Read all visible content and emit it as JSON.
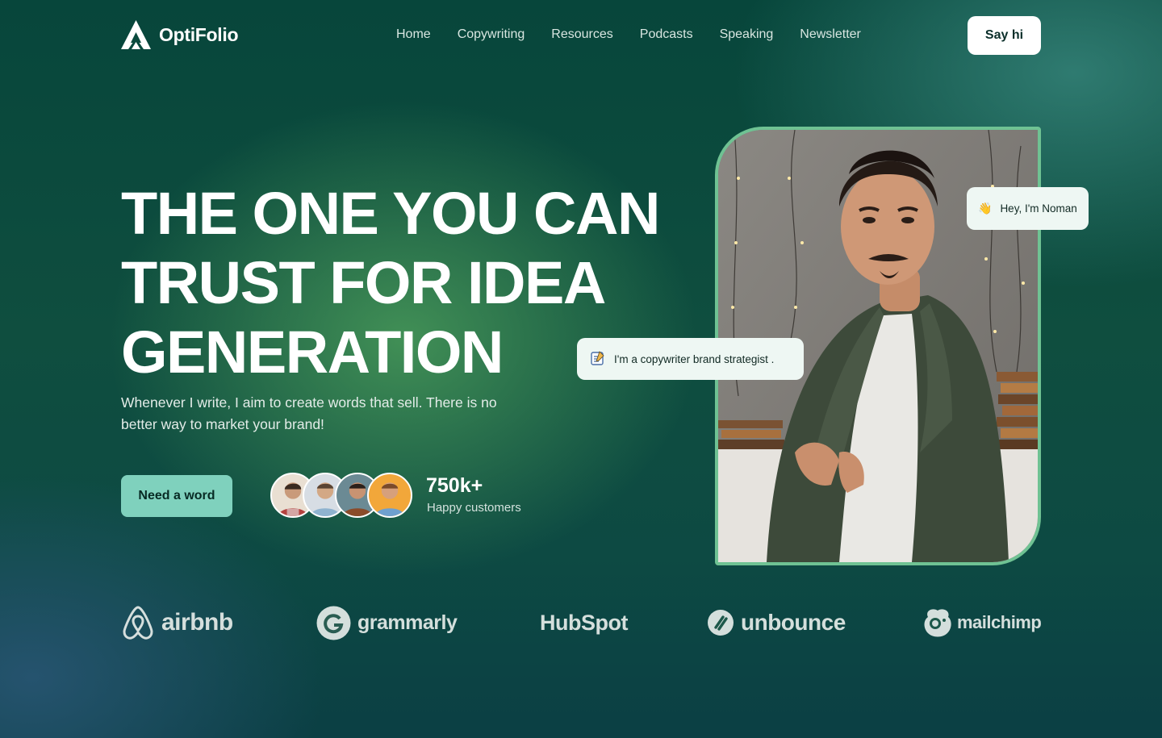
{
  "brand": {
    "name": "OptiFolio"
  },
  "nav": {
    "items": [
      "Home",
      "Copywriting",
      "Resources",
      "Podcasts",
      "Speaking",
      "Newsletter"
    ]
  },
  "header": {
    "cta_label": "Say hi"
  },
  "hero": {
    "headline_lines": [
      "THE ONE YOU CAN",
      "TRUST FOR IDEA",
      "GENERATION"
    ],
    "subtitle": "Whenever I write, I aim to create words that sell. There is no better way to market your brand!",
    "cta_label": "Need a word",
    "stat_value": "750k+",
    "stat_label": "Happy customers"
  },
  "bubbles": {
    "greeting": "Hey, I'm Noman",
    "greeting_icon": "waving-hand-icon",
    "role": "I'm a copywriter brand strategist .",
    "role_icon": "notepad-icon"
  },
  "brands": [
    "airbnb",
    "grammarly",
    "HubSpot",
    "unbounce",
    "mailchimp"
  ],
  "colors": {
    "accent": "#7fd1bd",
    "card_border": "#6fc293",
    "bubble_bg": "#eef7f3"
  }
}
